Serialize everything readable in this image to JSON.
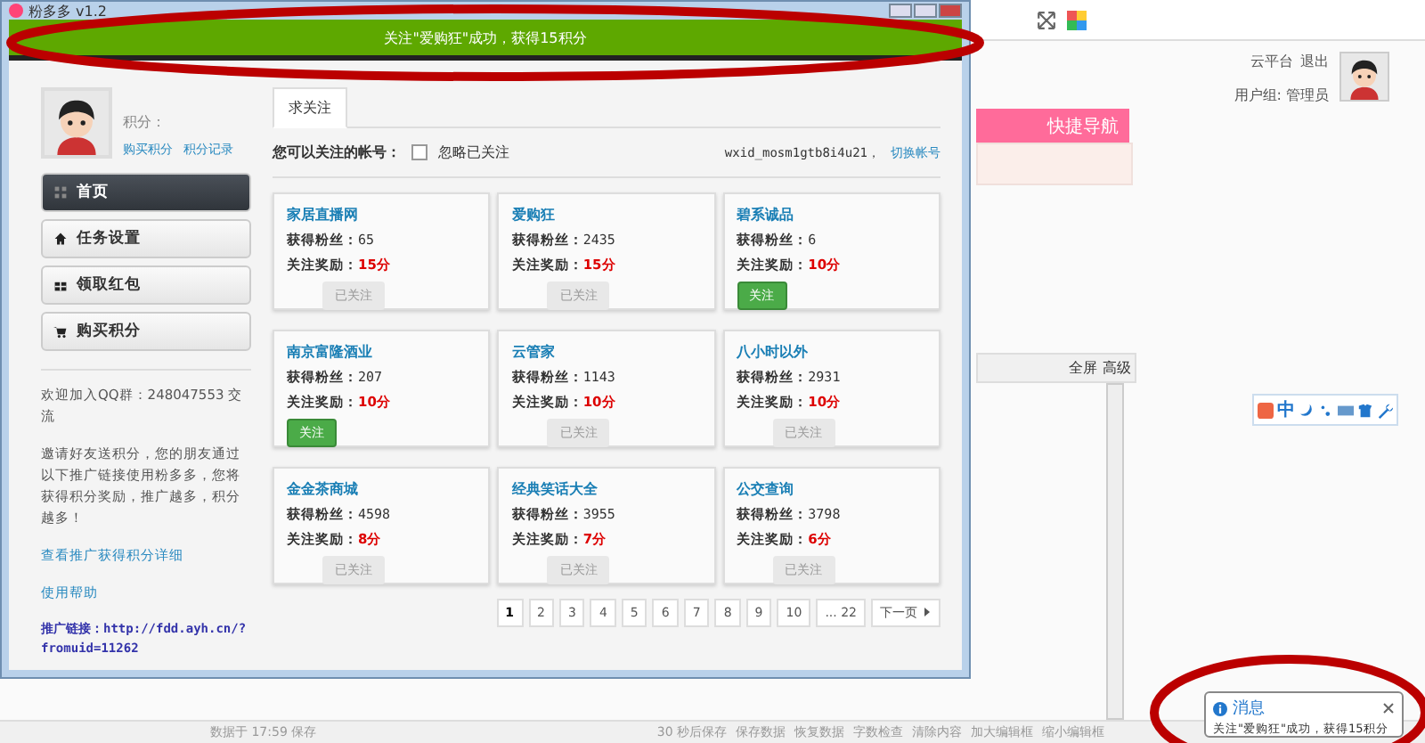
{
  "window": {
    "title": "粉多多 v1.2",
    "banner": "关注\"爱购狂\"成功，获得15积分"
  },
  "profile": {
    "points_label": "积分：",
    "links": [
      "购买积分",
      "积分记录"
    ]
  },
  "menu": [
    {
      "label": "首页",
      "selected": true
    },
    {
      "label": "任务设置",
      "selected": false
    },
    {
      "label": "领取红包",
      "selected": false
    },
    {
      "label": "购买积分",
      "selected": false
    }
  ],
  "sidebar_info": {
    "qq_group": "欢迎加入QQ群：248047553 交流",
    "invite": "邀请好友送积分，您的朋友通过以下推广链接使用粉多多，您将获得积分奖励，推广越多，积分越多！",
    "links": [
      "查看推广获得积分详细",
      "使用帮助"
    ],
    "promo_link": "推广链接：http://fdd.ayh.cn/?fromuid=11262"
  },
  "tabs": [
    {
      "label": "求关注",
      "selected": true
    }
  ],
  "filter": {
    "label": "您可以关注的帐号：",
    "ignore_followed": {
      "label": "忽略已关注",
      "checked": false
    },
    "account": "wxid_mosm1gtb8i4u21，",
    "switch_link": "切换帐号"
  },
  "cards": [
    {
      "name": "家居直播网",
      "fans_label": "获得粉丝：",
      "fans": "65",
      "reward_label": "关注奖励：",
      "reward": "15分",
      "button": "已关注",
      "followed": true
    },
    {
      "name": "爱购狂",
      "fans_label": "获得粉丝：",
      "fans": "2435",
      "reward_label": "关注奖励：",
      "reward": "15分",
      "button": "已关注",
      "followed": true
    },
    {
      "name": "碧系诚品",
      "fans_label": "获得粉丝：",
      "fans": "6",
      "reward_label": "关注奖励：",
      "reward": "10分",
      "button": "关注",
      "followed": false
    },
    {
      "name": "南京富隆酒业",
      "fans_label": "获得粉丝：",
      "fans": "207",
      "reward_label": "关注奖励：",
      "reward": "10分",
      "button": "关注",
      "followed": false
    },
    {
      "name": "云管家",
      "fans_label": "获得粉丝：",
      "fans": "1143",
      "reward_label": "关注奖励：",
      "reward": "10分",
      "button": "已关注",
      "followed": true
    },
    {
      "name": "八小时以外",
      "fans_label": "获得粉丝：",
      "fans": "2931",
      "reward_label": "关注奖励：",
      "reward": "10分",
      "button": "已关注",
      "followed": true
    },
    {
      "name": "金金茶商城",
      "fans_label": "获得粉丝：",
      "fans": "4598",
      "reward_label": "关注奖励：",
      "reward": "8分",
      "button": "已关注",
      "followed": true
    },
    {
      "name": "经典笑话大全",
      "fans_label": "获得粉丝：",
      "fans": "3955",
      "reward_label": "关注奖励：",
      "reward": "7分",
      "button": "已关注",
      "followed": true
    },
    {
      "name": "公交查询",
      "fans_label": "获得粉丝：",
      "fans": "3798",
      "reward_label": "关注奖励：",
      "reward": "6分",
      "button": "已关注",
      "followed": true
    }
  ],
  "pagination": {
    "pages": [
      {
        "label": "1",
        "selected": true
      },
      {
        "label": "2",
        "selected": false
      },
      {
        "label": "3",
        "selected": false
      },
      {
        "label": "4",
        "selected": false
      },
      {
        "label": "5",
        "selected": false
      },
      {
        "label": "6",
        "selected": false
      },
      {
        "label": "7",
        "selected": false
      },
      {
        "label": "8",
        "selected": false
      },
      {
        "label": "9",
        "selected": false
      },
      {
        "label": "10",
        "selected": false
      },
      {
        "label": "... 22",
        "selected": false
      }
    ],
    "next": "下一页"
  },
  "background_page": {
    "header_links": [
      "云平台",
      "退出"
    ],
    "user_group": "用户组: 管理员",
    "quick_nav": "快捷导航",
    "editor_buttons": [
      "全屏",
      "高级"
    ],
    "ime_label": "中",
    "status_left": "数据于 17:59 保存",
    "status_links": [
      "30 秒后保存",
      "保存数据",
      "恢复数据",
      "字数检查",
      "清除内容",
      "加大编辑框",
      "缩小编辑框"
    ]
  },
  "toast": {
    "title": "消息",
    "message": "关注\"爱购狂\"成功，获得15积分"
  }
}
